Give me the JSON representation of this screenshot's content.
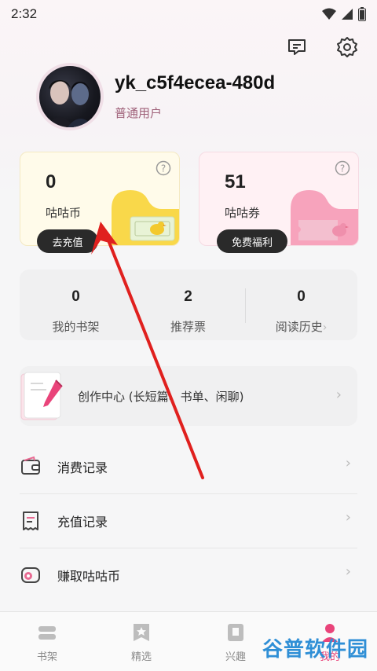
{
  "status_bar": {
    "time": "2:32"
  },
  "profile": {
    "username": "yk_c5f4ecea-480d",
    "level": "普通用户"
  },
  "wallet": {
    "coins": {
      "value": "0",
      "label": "咕咕币",
      "button": "去充值"
    },
    "tickets": {
      "value": "51",
      "label": "咕咕券",
      "button": "免费福利"
    }
  },
  "stats": [
    {
      "value": "0",
      "label": "我的书架"
    },
    {
      "value": "2",
      "label": "推荐票"
    },
    {
      "value": "0",
      "label": "阅读历史"
    }
  ],
  "create_center": {
    "label": "创作中心 (长短篇、书单、闲聊)"
  },
  "menu": [
    {
      "label": "消费记录",
      "icon": "wallet-icon"
    },
    {
      "label": "充值记录",
      "icon": "receipt-icon"
    },
    {
      "label": "赚取咕咕币",
      "icon": "coin-earn-icon"
    }
  ],
  "tabbar": [
    {
      "label": "书架",
      "icon": "bookshelf-icon"
    },
    {
      "label": "精选",
      "icon": "featured-icon"
    },
    {
      "label": "兴趣",
      "icon": "interest-icon"
    },
    {
      "label": "我的",
      "icon": "profile-icon"
    }
  ],
  "watermark": "谷普软件园",
  "colors": {
    "accent_pink": "#e86a92",
    "annotation_red": "#e0201e",
    "dark_button": "#2a2a2a"
  }
}
